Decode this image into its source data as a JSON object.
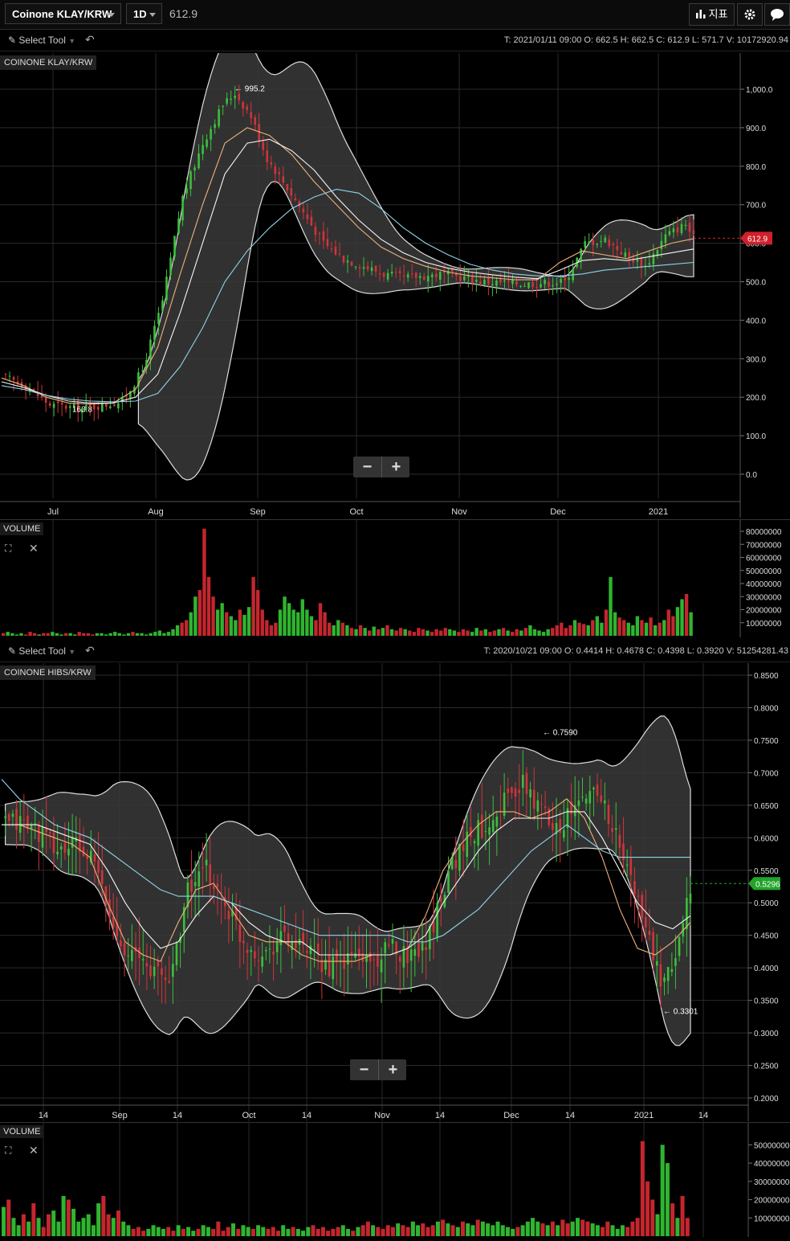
{
  "toolbar": {
    "symbol": "Coinone KLAY/KRW",
    "interval": "1D",
    "price": "612.9",
    "indicator_label": "지표",
    "settings_icon": "gear-icon",
    "chat_icon": "chat-bubble-icon"
  },
  "chart1": {
    "tool_label": "Select Tool",
    "ohlc": "T: 2021/01/11 09:00   O: 662.5   H: 662.5   C: 612.9   L: 571.7   V: 10172920.94",
    "symbol_tag": "COINONE KLAY/KRW",
    "last_price": "612.9",
    "volume_tag": "VOLUME"
  },
  "chart2": {
    "tool_label": "Select Tool",
    "ohlc": "T: 2020/10/21 09:00   O: 0.4414   H: 0.4678   C: 0.4398   L: 0.3920   V: 51254281.43",
    "symbol_tag": "COINONE HIBS/KRW",
    "last_price": "0.5296",
    "volume_tag": "VOLUME"
  },
  "chart_data": [
    {
      "type": "candlestick",
      "title": "COINONE KLAY/KRW",
      "xlabel": "",
      "ylabel": "",
      "ylim": [
        0,
        1000
      ],
      "y_ticks": [
        "1,000.0",
        "900.0",
        "800.0",
        "700.0",
        "600.0",
        "500.0",
        "400.0",
        "300.0",
        "200.0",
        "100.0",
        "0.0"
      ],
      "x_ticks": [
        "Jul",
        "Aug",
        "Sep",
        "Oct",
        "Nov",
        "Dec",
        "2021"
      ],
      "annotations": [
        {
          "label": "← 995.2",
          "value": 995.2
        },
        {
          "label": "163.8",
          "value": 163.8
        }
      ],
      "current_price": 612.9,
      "close_path": [
        [
          0,
          255
        ],
        [
          6,
          230
        ],
        [
          12,
          180
        ],
        [
          20,
          170
        ],
        [
          27,
          183
        ],
        [
          30,
          190
        ],
        [
          35,
          270
        ],
        [
          40,
          450
        ],
        [
          45,
          720
        ],
        [
          50,
          860
        ],
        [
          55,
          960
        ],
        [
          58,
          990
        ],
        [
          62,
          930
        ],
        [
          66,
          820
        ],
        [
          70,
          760
        ],
        [
          75,
          680
        ],
        [
          80,
          600
        ],
        [
          85,
          560
        ],
        [
          90,
          540
        ],
        [
          95,
          520
        ],
        [
          100,
          510
        ],
        [
          110,
          520
        ],
        [
          120,
          500
        ],
        [
          130,
          495
        ],
        [
          140,
          500
        ],
        [
          145,
          600
        ],
        [
          150,
          610
        ],
        [
          155,
          570
        ],
        [
          160,
          540
        ],
        [
          165,
          620
        ],
        [
          170,
          650
        ],
        [
          172,
          612.9
        ]
      ],
      "series": [
        {
          "name": "MA short",
          "values": [
            250,
            230,
            200,
            185,
            182,
            185,
            220,
            330,
            520,
            700,
            860,
            900,
            880,
            830,
            760,
            700,
            640,
            590,
            560,
            540,
            525,
            515,
            510,
            505,
            505,
            550,
            580,
            570,
            560,
            580,
            600,
            612
          ]
        },
        {
          "name": "MA medium",
          "values": [
            240,
            225,
            205,
            190,
            185,
            185,
            200,
            260,
            420,
            600,
            780,
            860,
            870,
            840,
            790,
            720,
            660,
            610,
            575,
            550,
            535,
            525,
            518,
            512,
            508,
            530,
            555,
            560,
            555,
            565,
            575,
            585
          ]
        },
        {
          "name": "MA long",
          "values": [
            230,
            220,
            205,
            195,
            190,
            188,
            190,
            210,
            280,
            380,
            500,
            580,
            640,
            690,
            720,
            740,
            730,
            690,
            640,
            600,
            570,
            545,
            530,
            520,
            515,
            515,
            520,
            530,
            535,
            540,
            545,
            550
          ]
        }
      ],
      "volume": {
        "label": "VOLUME",
        "y_ticks": [
          "80000000",
          "70000000",
          "60000000",
          "50000000",
          "40000000",
          "30000000",
          "20000000",
          "10000000"
        ],
        "ylim": [
          0,
          80000000
        ],
        "values": [
          2,
          3,
          2,
          1,
          2,
          1,
          3,
          2,
          1,
          2,
          2,
          3,
          2,
          1,
          2,
          2,
          1,
          3,
          2,
          2,
          1,
          2,
          2,
          1,
          2,
          3,
          2,
          1,
          2,
          3,
          2,
          2,
          1,
          2,
          3,
          4,
          2,
          3,
          5,
          8,
          10,
          12,
          18,
          30,
          35,
          82,
          45,
          30,
          20,
          25,
          18,
          15,
          12,
          20,
          16,
          22,
          45,
          35,
          20,
          12,
          8,
          10,
          20,
          30,
          25,
          20,
          18,
          28,
          20,
          15,
          12,
          25,
          18,
          10,
          8,
          12,
          10,
          8,
          6,
          5,
          8,
          6,
          4,
          7,
          5,
          6,
          8,
          5,
          4,
          6,
          5,
          4,
          3,
          6,
          5,
          4,
          3,
          5,
          4,
          6,
          5,
          4,
          3,
          5,
          4,
          3,
          6,
          4,
          5,
          3,
          4,
          5,
          6,
          4,
          3,
          5,
          4,
          6,
          8,
          5,
          4,
          3,
          5,
          6,
          8,
          10,
          6,
          8,
          12,
          10,
          9,
          8,
          12,
          15,
          10,
          20,
          45,
          18,
          14,
          12,
          10,
          8,
          15,
          12,
          10,
          14,
          8,
          10,
          12,
          20,
          15,
          22,
          28,
          32,
          18
        ]
      }
    },
    {
      "type": "candlestick",
      "title": "COINONE HIBS/KRW",
      "xlabel": "",
      "ylabel": "",
      "ylim": [
        0.2,
        0.85
      ],
      "y_ticks": [
        "0.8500",
        "0.8000",
        "0.7500",
        "0.7000",
        "0.6500",
        "0.6000",
        "0.5500",
        "0.5000",
        "0.4500",
        "0.4000",
        "0.3500",
        "0.3000",
        "0.2500",
        "0.2000"
      ],
      "x_ticks": [
        "14",
        "Sep",
        "14",
        "Oct",
        "14",
        "Nov",
        "14",
        "Dec",
        "14",
        "2021",
        "14"
      ],
      "annotations": [
        {
          "label": "← 0.7590",
          "value": 0.759
        },
        {
          "label": "← 0.3301",
          "value": 0.3301
        }
      ],
      "current_price": 0.5296,
      "close_path": [
        [
          0,
          0.62
        ],
        [
          10,
          0.625
        ],
        [
          20,
          0.61
        ],
        [
          30,
          0.58
        ],
        [
          40,
          0.59
        ],
        [
          50,
          0.56
        ],
        [
          60,
          0.46
        ],
        [
          70,
          0.42
        ],
        [
          80,
          0.4
        ],
        [
          90,
          0.38
        ],
        [
          100,
          0.52
        ],
        [
          110,
          0.55
        ],
        [
          120,
          0.5
        ],
        [
          130,
          0.44
        ],
        [
          140,
          0.42
        ],
        [
          150,
          0.45
        ],
        [
          160,
          0.43
        ],
        [
          170,
          0.41
        ],
        [
          180,
          0.4
        ],
        [
          190,
          0.42
        ],
        [
          200,
          0.41
        ],
        [
          210,
          0.43
        ],
        [
          220,
          0.42
        ],
        [
          230,
          0.45
        ],
        [
          240,
          0.55
        ],
        [
          250,
          0.6
        ],
        [
          260,
          0.62
        ],
        [
          270,
          0.66
        ],
        [
          280,
          0.68
        ],
        [
          290,
          0.64
        ],
        [
          300,
          0.62
        ],
        [
          310,
          0.65
        ],
        [
          320,
          0.68
        ],
        [
          330,
          0.6
        ],
        [
          340,
          0.52
        ],
        [
          350,
          0.42
        ],
        [
          355,
          0.36
        ],
        [
          360,
          0.4
        ],
        [
          365,
          0.46
        ],
        [
          370,
          0.5296
        ]
      ],
      "series": [
        {
          "name": "MA short",
          "values": [
            0.62,
            0.62,
            0.61,
            0.6,
            0.59,
            0.57,
            0.5,
            0.44,
            0.42,
            0.41,
            0.47,
            0.52,
            0.53,
            0.49,
            0.45,
            0.44,
            0.44,
            0.42,
            0.41,
            0.41,
            0.41,
            0.42,
            0.42,
            0.43,
            0.48,
            0.55,
            0.59,
            0.62,
            0.64,
            0.64,
            0.63,
            0.64,
            0.66,
            0.63,
            0.57,
            0.49,
            0.43,
            0.42,
            0.44,
            0.47
          ]
        },
        {
          "name": "MA medium",
          "values": [
            0.62,
            0.62,
            0.62,
            0.61,
            0.6,
            0.59,
            0.55,
            0.5,
            0.46,
            0.43,
            0.44,
            0.48,
            0.51,
            0.5,
            0.47,
            0.45,
            0.44,
            0.44,
            0.42,
            0.42,
            0.42,
            0.42,
            0.42,
            0.43,
            0.45,
            0.5,
            0.54,
            0.58,
            0.61,
            0.63,
            0.63,
            0.63,
            0.64,
            0.64,
            0.6,
            0.55,
            0.5,
            0.47,
            0.46,
            0.48
          ]
        },
        {
          "name": "MA long",
          "values": [
            0.69,
            0.66,
            0.64,
            0.62,
            0.61,
            0.6,
            0.58,
            0.56,
            0.54,
            0.52,
            0.51,
            0.51,
            0.51,
            0.5,
            0.49,
            0.48,
            0.47,
            0.46,
            0.45,
            0.45,
            0.45,
            0.45,
            0.45,
            0.44,
            0.44,
            0.45,
            0.47,
            0.49,
            0.52,
            0.55,
            0.58,
            0.6,
            0.62,
            0.6,
            0.58,
            0.57,
            0.57,
            0.57,
            0.57,
            0.57
          ]
        }
      ],
      "volume": {
        "label": "VOLUME",
        "y_ticks": [
          "50000000",
          "40000000",
          "30000000",
          "20000000",
          "10000000"
        ],
        "ylim": [
          0,
          55000000
        ],
        "values": [
          16,
          20,
          10,
          6,
          12,
          8,
          18,
          10,
          5,
          12,
          14,
          8,
          22,
          20,
          15,
          8,
          10,
          12,
          6,
          18,
          22,
          12,
          10,
          14,
          8,
          6,
          4,
          5,
          3,
          4,
          6,
          5,
          4,
          5,
          3,
          6,
          4,
          5,
          3,
          4,
          6,
          5,
          4,
          8,
          3,
          5,
          7,
          4,
          6,
          5,
          4,
          6,
          5,
          4,
          5,
          3,
          6,
          4,
          5,
          4,
          3,
          5,
          6,
          4,
          5,
          3,
          4,
          5,
          6,
          4,
          3,
          5,
          6,
          8,
          6,
          5,
          4,
          6,
          5,
          7,
          6,
          5,
          8,
          6,
          7,
          5,
          6,
          8,
          9,
          7,
          6,
          5,
          8,
          7,
          6,
          9,
          8,
          7,
          6,
          8,
          6,
          5,
          4,
          5,
          6,
          8,
          10,
          8,
          7,
          6,
          8,
          6,
          9,
          7,
          8,
          10,
          9,
          8,
          7,
          6,
          5,
          8,
          6,
          4,
          6,
          5,
          8,
          10,
          52,
          30,
          20,
          12,
          50,
          40,
          18,
          10,
          22,
          10
        ]
      }
    }
  ]
}
